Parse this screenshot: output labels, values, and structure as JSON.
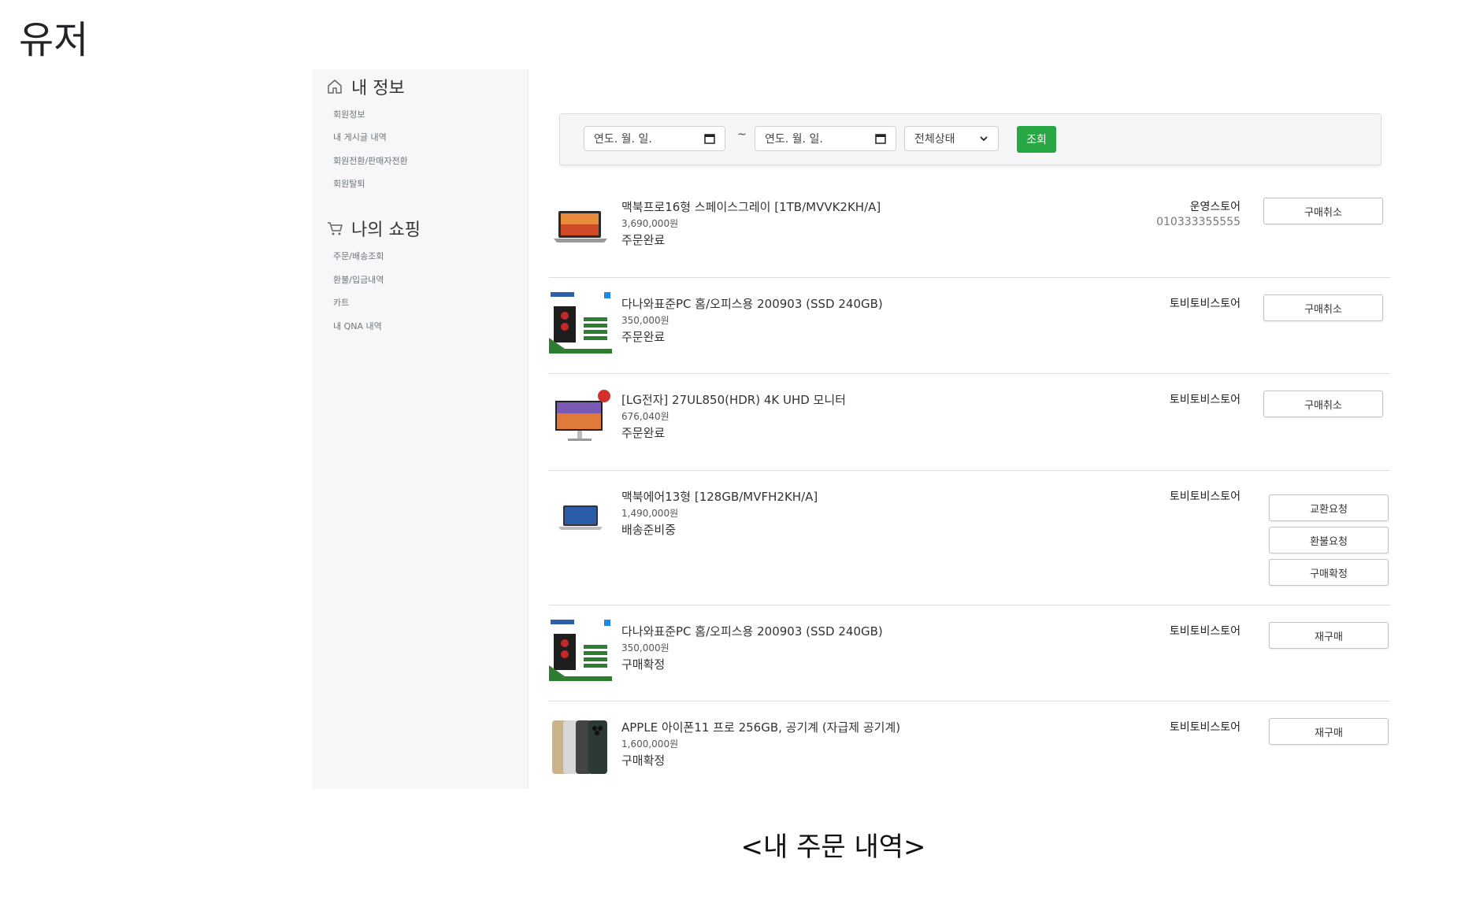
{
  "page_heading": "유저",
  "sidebar": {
    "my_info": {
      "title": "내 정보",
      "items": [
        "회원정보",
        "내 게시글 내역",
        "회원전환/판매자전환",
        "회원탈퇴"
      ]
    },
    "my_shopping": {
      "title": "나의 쇼핑",
      "items": [
        "주문/배송조회",
        "환불/입금내역",
        "카트",
        "내 QNA 내역"
      ]
    }
  },
  "filter": {
    "start_date_placeholder": "연도. 월. 일.",
    "separator": "~",
    "end_date_placeholder": "연도. 월. 일.",
    "status_selected": "전체상태",
    "search_label": "조회",
    "search_color": "#28a745"
  },
  "orders": [
    {
      "name": "맥북프로16형 스페이스그레이 [1TB/MVVK2KH/A]",
      "price": "3,690,000원",
      "status": "주문완료",
      "store": "운영스토어",
      "phone": "010333355555",
      "thumbnail": "macbook-pro-image",
      "actions": [
        "구매취소"
      ]
    },
    {
      "name": "다나와표준PC 홈/오피스용 200903 (SSD 240GB)",
      "price": "350,000원",
      "status": "주문완료",
      "store": "토비토비스토어",
      "thumbnail": "desktop-pc-image",
      "actions": [
        "구매취소"
      ]
    },
    {
      "name": "[LG전자] 27UL850(HDR) 4K UHD 모니터",
      "price": "676,040원",
      "status": "주문완료",
      "store": "토비토비스토어",
      "thumbnail": "monitor-image",
      "actions": [
        "구매취소"
      ]
    },
    {
      "name": "맥북에어13형 [128GB/MVFH2KH/A]",
      "price": "1,490,000원",
      "status": "배송준비중",
      "store": "토비토비스토어",
      "thumbnail": "macbook-air-image",
      "actions": [
        "교환요청",
        "환불요청",
        "구매확정"
      ]
    },
    {
      "name": "다나와표준PC 홈/오피스용 200903 (SSD 240GB)",
      "price": "350,000원",
      "status": "구매확정",
      "store": "토비토비스토어",
      "thumbnail": "desktop-pc-image",
      "actions": [
        "재구매"
      ]
    },
    {
      "name": "APPLE 아이폰11 프로 256GB, 공기계 (자급제 공기계)",
      "price": "1,600,000원",
      "status": "구매확정",
      "store": "토비토비스토어",
      "thumbnail": "iphone-image",
      "actions": [
        "재구매"
      ]
    }
  ],
  "caption": "<내 주문 내역>"
}
